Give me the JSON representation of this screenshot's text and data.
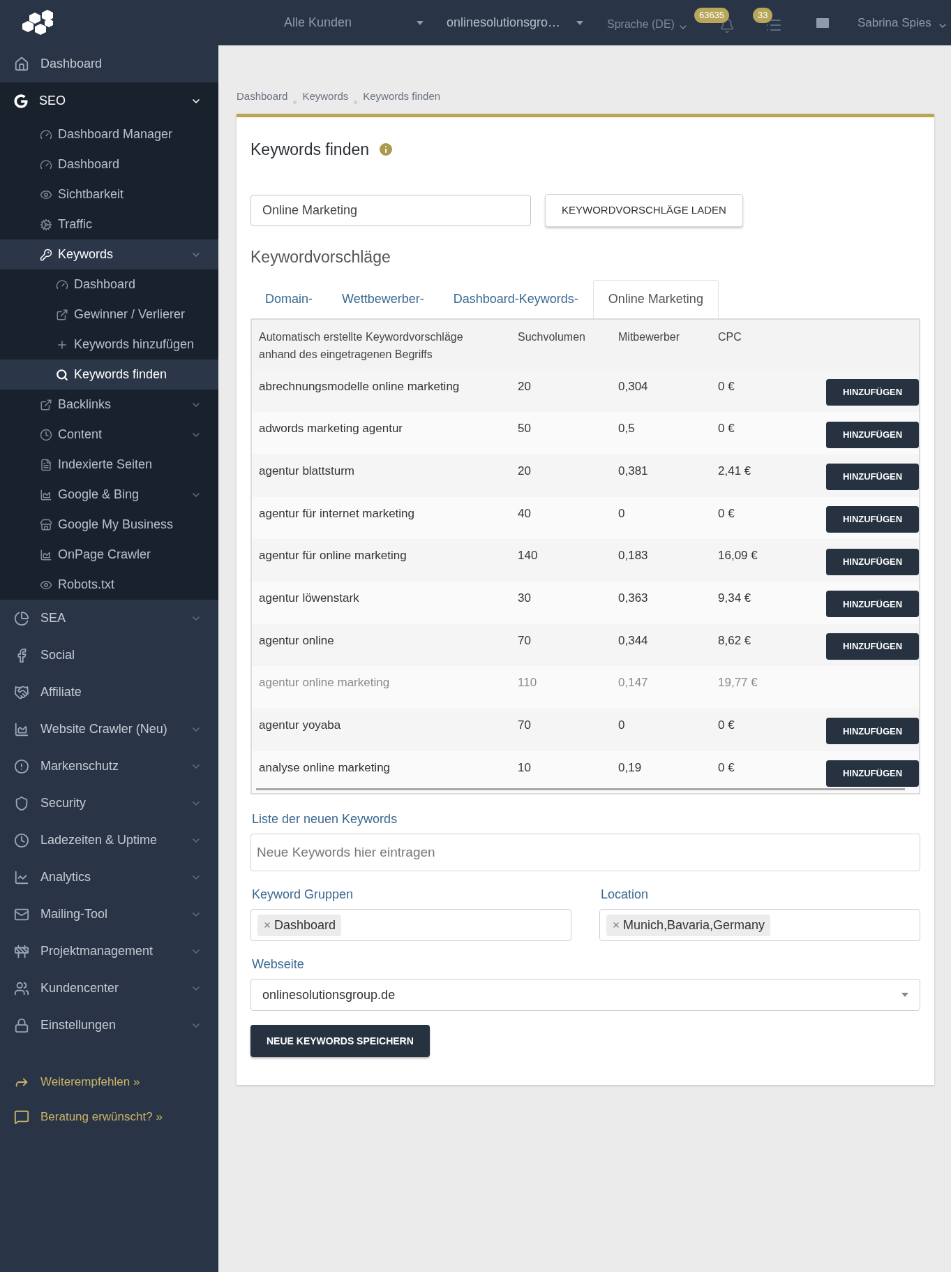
{
  "topbar": {
    "customer_select": "Alle Kunden",
    "project_select": "onlinesolutionsgro…",
    "language": "Sprache (DE)",
    "notifications_count": "63635",
    "tasks_count": "33",
    "user": "Sabrina Spies"
  },
  "sidebar": {
    "items": [
      {
        "label": "Dashboard",
        "kind": "link"
      },
      {
        "label": "SEO",
        "kind": "menu",
        "expanded": true,
        "children": [
          {
            "label": "Dashboard Manager",
            "kind": "link"
          },
          {
            "label": "Dashboard",
            "kind": "link"
          },
          {
            "label": "Sichtbarkeit",
            "kind": "link"
          },
          {
            "label": "Traffic",
            "kind": "link"
          },
          {
            "label": "Keywords",
            "kind": "menu",
            "expanded": true,
            "children": [
              {
                "label": "Dashboard",
                "selected": false
              },
              {
                "label": "Gewinner / Verlierer",
                "selected": false
              },
              {
                "label": "Keywords hinzufügen",
                "selected": false
              },
              {
                "label": "Keywords finden",
                "selected": true
              }
            ]
          },
          {
            "label": "Backlinks",
            "kind": "menu",
            "expanded": false
          },
          {
            "label": "Content",
            "kind": "menu",
            "expanded": false
          },
          {
            "label": "Indexierte Seiten",
            "kind": "link"
          },
          {
            "label": "Google & Bing",
            "kind": "menu",
            "expanded": false
          },
          {
            "label": "Google My Business",
            "kind": "link"
          },
          {
            "label": "OnPage Crawler",
            "kind": "link"
          },
          {
            "label": "Robots.txt",
            "kind": "link"
          }
        ]
      },
      {
        "label": "SEA",
        "kind": "menu",
        "expanded": false
      },
      {
        "label": "Social",
        "kind": "link"
      },
      {
        "label": "Affiliate",
        "kind": "link"
      },
      {
        "label": "Website Crawler (Neu)",
        "kind": "menu",
        "expanded": false
      },
      {
        "label": "Markenschutz",
        "kind": "menu",
        "expanded": false
      },
      {
        "label": "Security",
        "kind": "menu",
        "expanded": false
      },
      {
        "label": "Ladezeiten & Uptime",
        "kind": "menu",
        "expanded": false
      },
      {
        "label": "Analytics",
        "kind": "menu",
        "expanded": false
      },
      {
        "label": "Mailing-Tool",
        "kind": "menu",
        "expanded": false
      },
      {
        "label": "Projektmanagement",
        "kind": "menu",
        "expanded": false
      },
      {
        "label": "Kundencenter",
        "kind": "menu",
        "expanded": false
      },
      {
        "label": "Einstellungen",
        "kind": "menu",
        "expanded": false
      }
    ],
    "footer_links": [
      "Weiterempfehlen »",
      "Beratung erwünscht? »"
    ]
  },
  "breadcrumb": [
    "Dashboard",
    "Keywords",
    "Keywords finden"
  ],
  "card": {
    "title": "Keywords finden",
    "search": {
      "value": "Online Marketing"
    },
    "load_button": "KEYWORDVORSCHLÄGE LADEN",
    "section_title": "Keywordvorschläge",
    "tabs": [
      {
        "label": "Domain-",
        "selected": false
      },
      {
        "label": "Wettbewerber-",
        "selected": false
      },
      {
        "label": "Dashboard-Keywords-",
        "selected": false
      },
      {
        "label": "Online Marketing",
        "selected": true
      }
    ],
    "table": {
      "columns": [
        "Automatisch erstellte Keywordvorschläge anhand des eingetragenen Begriffs",
        "Suchvolumen",
        "Mitbewerber",
        "CPC"
      ],
      "rows": [
        {
          "keyword": "abrechnungsmodelle online marketing",
          "volume": "20",
          "competition": "0,304",
          "cpc": "0 €",
          "added": false,
          "button": "HINZUFÜGEN"
        },
        {
          "keyword": "adwords marketing agentur",
          "volume": "50",
          "competition": "0,5",
          "cpc": "0 €",
          "added": false,
          "button": "HINZUFÜGEN"
        },
        {
          "keyword": "agentur blattsturm",
          "volume": "20",
          "competition": "0,381",
          "cpc": "2,41 €",
          "added": false,
          "button": "HINZUFÜGEN"
        },
        {
          "keyword": "agentur für internet marketing",
          "volume": "40",
          "competition": "0",
          "cpc": "0 €",
          "added": false,
          "button": "HINZUFÜGEN"
        },
        {
          "keyword": "agentur für online marketing",
          "volume": "140",
          "competition": "0,183",
          "cpc": "16,09 €",
          "added": false,
          "button": "HINZUFÜGEN"
        },
        {
          "keyword": "agentur löwenstark",
          "volume": "30",
          "competition": "0,363",
          "cpc": "9,34 €",
          "added": false,
          "button": "HINZUFÜGEN"
        },
        {
          "keyword": "agentur online",
          "volume": "70",
          "competition": "0,344",
          "cpc": "8,62 €",
          "added": false,
          "button": "HINZUFÜGEN"
        },
        {
          "keyword": "agentur online marketing",
          "volume": "110",
          "competition": "0,147",
          "cpc": "19,77 €",
          "added": true
        },
        {
          "keyword": "agentur yoyaba",
          "volume": "70",
          "competition": "0",
          "cpc": "0 €",
          "added": false,
          "button": "HINZUFÜGEN"
        },
        {
          "keyword": "analyse online marketing",
          "volume": "10",
          "competition": "0,19",
          "cpc": "0 €",
          "added": false,
          "button": "HINZUFÜGEN"
        }
      ]
    },
    "new_keywords": {
      "label": "Liste der neuen Keywords",
      "placeholder": "Neue Keywords hier eintragen"
    },
    "groups": {
      "label": "Keyword Gruppen",
      "tags": [
        "Dashboard"
      ]
    },
    "location": {
      "label": "Location",
      "tags": [
        "Munich,Bavaria,Germany"
      ]
    },
    "website": {
      "label": "Webseite",
      "value": "onlinesolutionsgroup.de"
    },
    "save_button": "NEUE KEYWORDS SPEICHERN"
  }
}
